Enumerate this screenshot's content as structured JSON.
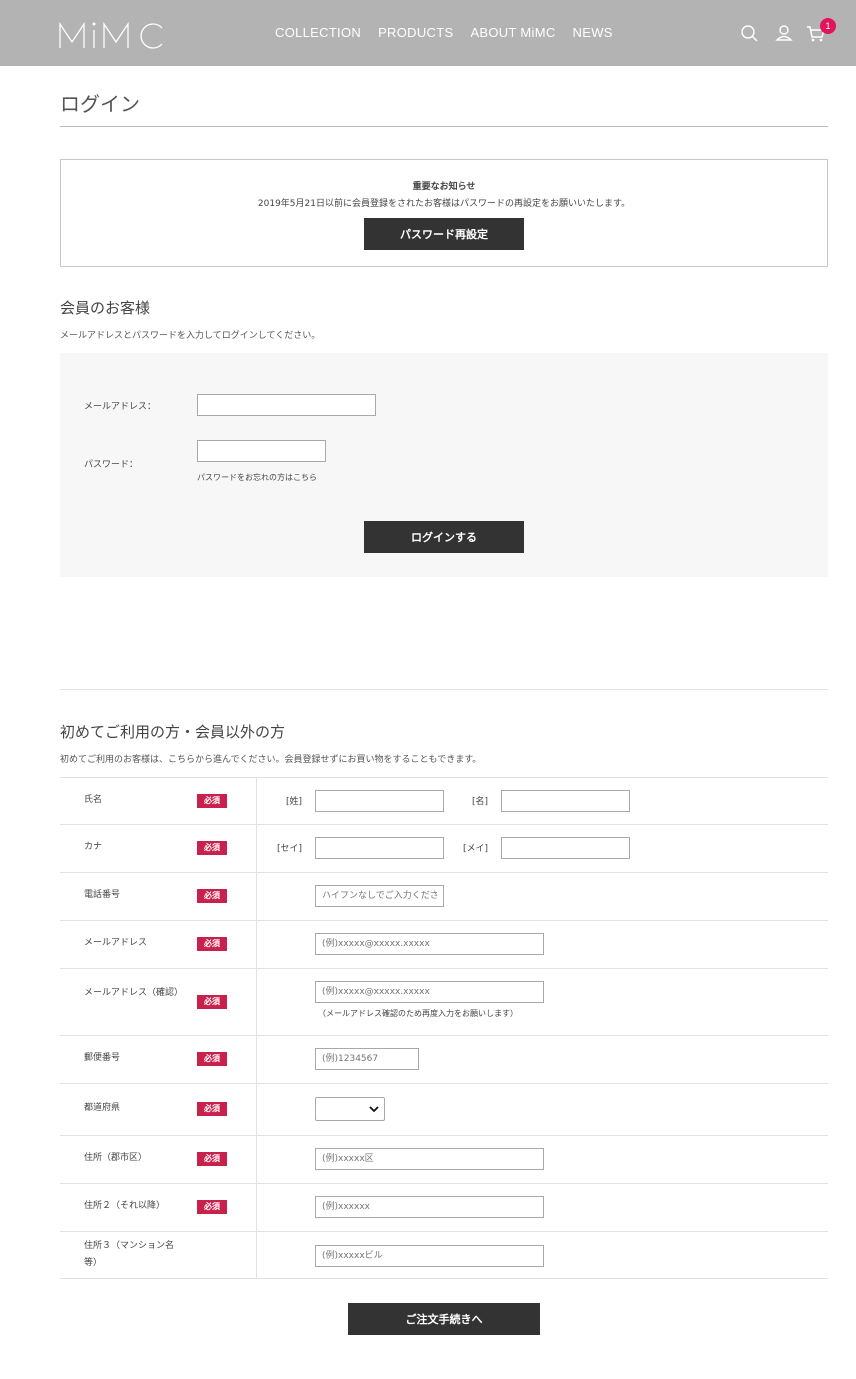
{
  "header": {
    "logo_text": "MiMC",
    "nav": [
      "COLLECTION",
      "PRODUCTS",
      "ABOUT MiMC",
      "NEWS"
    ],
    "icons": [
      "search-icon",
      "account-icon",
      "cart-icon"
    ],
    "cart_count": "1",
    "badge_color": "#e2145c",
    "bg_color": "#b3b3b3"
  },
  "page": {
    "title": "ログイン"
  },
  "notice": {
    "title": "重要なお知らせ",
    "text": "2019年5月21日以前に会員登録をされたお客様はパスワードの再設定をお願いいたします。",
    "button": "パスワード再設定"
  },
  "member": {
    "title": "会員のお客様",
    "desc": "メールアドレスとパスワードを入力してログインしてください。",
    "email_label": "メールアドレス：",
    "password_label": "パスワード：",
    "forgot_link": "パスワードをお忘れの方はこちら",
    "login_button": "ログインする"
  },
  "guest": {
    "title": "初めてご利用の方・会員以外の方",
    "desc": "初めてご利用のお客様は、こちらから進んでください。会員登録せずにお買い物をすることもできます。",
    "required_badge": "必須",
    "required_color": "#c8214c",
    "rows": {
      "name": {
        "label": "氏名",
        "last": "[姓]",
        "first": "[名]"
      },
      "kana": {
        "label": "カナ",
        "last": "[セイ]",
        "first": "[メイ]"
      },
      "phone": {
        "label": "電話番号",
        "placeholder": "ハイフンなしでご入力ください"
      },
      "email": {
        "label": "メールアドレス",
        "placeholder": "(例)xxxxx@xxxxx.xxxxx"
      },
      "email_confirm": {
        "label": "メールアドレス（確認）",
        "placeholder": "(例)xxxxx@xxxxx.xxxxx",
        "note": "（メールアドレス確認のため再度入力をお願いします）"
      },
      "zip": {
        "label": "郵便番号",
        "placeholder": "(例)1234567"
      },
      "prefecture": {
        "label": "都道府県",
        "selected": ""
      },
      "address1": {
        "label": "住所（郡市区）",
        "placeholder": "(例)xxxxx区"
      },
      "address2": {
        "label": "住所２（それ以降）",
        "placeholder": "(例)xxxxxx"
      },
      "address3": {
        "label": "住所３（マンション名等）",
        "placeholder": "(例)xxxxxビル"
      }
    },
    "order_button": "ご注文手続きへ"
  }
}
